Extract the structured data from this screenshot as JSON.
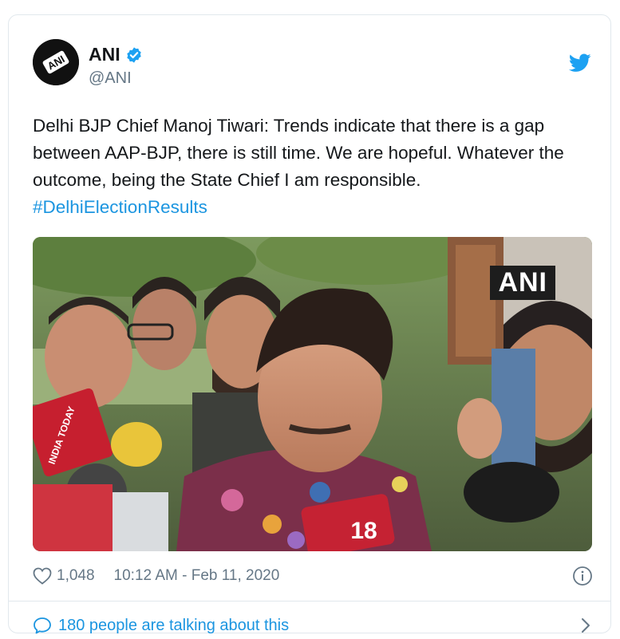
{
  "tweet": {
    "author": {
      "name": "ANI",
      "handle": "@ANI",
      "verified": true,
      "avatar_text": "ANI"
    },
    "text": "Delhi BJP Chief Manoj Tiwari: Trends indicate that there is a gap between AAP-BJP, there is still time. We are hopeful. Whatever the outcome, being the State Chief I am responsible.",
    "hashtag": "#DelhiElectionResults",
    "media": {
      "watermark": "ANI",
      "mic_labels": [
        "18",
        "INDIA TODAY"
      ]
    },
    "likes": "1,048",
    "timestamp": "10:12 AM - Feb 11, 2020",
    "footer": "180 people are talking about this"
  },
  "icons": [
    "twitter-logo-icon",
    "verified-badge-icon",
    "heart-icon",
    "info-icon",
    "speech-bubble-icon",
    "chevron-right-icon"
  ],
  "colors": {
    "accent": "#1b95e0",
    "muted": "#657786",
    "text": "#14171a",
    "border": "#e1e8ed"
  }
}
